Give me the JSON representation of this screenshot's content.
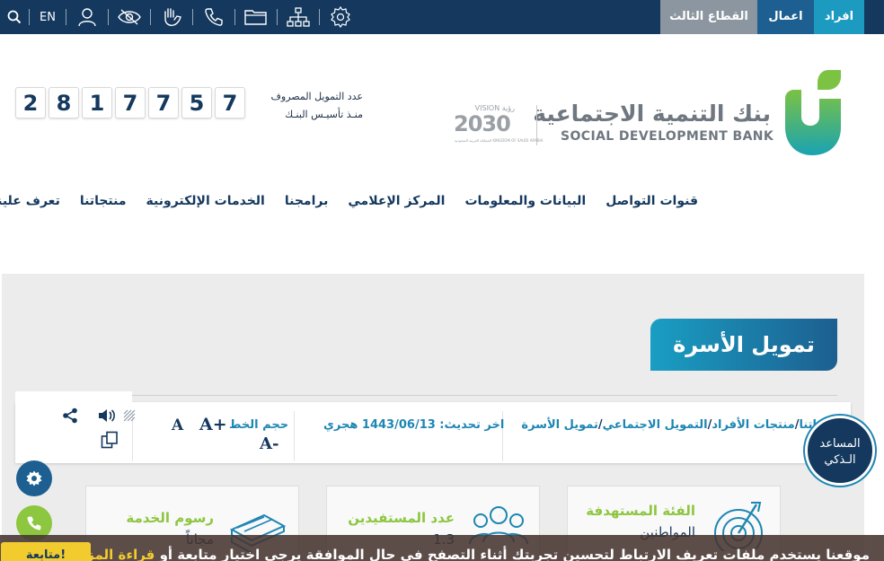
{
  "topbar": {
    "segments": {
      "third_sector": "القطاع الثالث",
      "business": "اعمال",
      "individuals": "افراد"
    },
    "language": "EN",
    "icons": [
      "search-icon",
      "user-icon",
      "eye-slash-icon",
      "sign-language-icon",
      "phone-icon",
      "folder-icon",
      "sitemap-icon",
      "settings-badge-icon"
    ]
  },
  "header": {
    "bank_name_ar": "بنك التنمية الاجتماعية",
    "bank_name_en": "SOCIAL DEVELOPMENT BANK",
    "vision": {
      "label": "VISION رؤية",
      "year": "2030",
      "sub": "المملكة العربية السعودية KINGDOM OF SAUDI ARABIA"
    },
    "funding_caption_line1": "عدد التمويل المصروف",
    "funding_caption_line2": "منـذ تأسيـس البنـك",
    "funding_digits": [
      "2",
      "8",
      "1",
      "7",
      "7",
      "5",
      "7"
    ]
  },
  "nav": {
    "items": [
      "تعرف علينا",
      "منتجاتنا",
      "الخدمات الإلكترونية",
      "برامجنا",
      "المركز الإعلامي",
      "البيانات والمعلومات",
      "قنوات التواصل"
    ]
  },
  "page": {
    "title": "تمويل الأسرة",
    "breadcrumb": [
      "اتنا",
      "منتجات الأفراد",
      "التمويل الاجتماعي",
      "تمويل الأسرة"
    ],
    "last_update": "اخر تحديث: 1443/06/13 هجري",
    "font_size_label": "حجم الخط",
    "font_increase": "A+",
    "font_large": "A",
    "font_decrease": "A-"
  },
  "cards": [
    {
      "title": "الفئة المستهدفة",
      "value": "المواطنين",
      "icon": "target-icon"
    },
    {
      "title": "عدد المستفيدين",
      "value": "1.3",
      "icon": "people-icon"
    },
    {
      "title": "رسوم الخدمة",
      "value": "مجاناً",
      "icon": "money-stack-icon"
    }
  ],
  "assistant": {
    "line1": "المساعد",
    "line2": "الـذكي"
  },
  "cookie": {
    "text": "موقعنا يستخدم ملفات تعريف الارتباط لتحسين تجربتك أثناء التصفح في حال الموافقة يرجى اختيار متابعة أو",
    "link": "قراءة المزيد",
    "button": "متابعة!"
  },
  "colors": {
    "navy": "#14385e",
    "teal": "#1d9ac0",
    "green": "#8dc63f",
    "gray_tab": "#8c96a0",
    "cookie_yellow": "#f2cc2e"
  }
}
